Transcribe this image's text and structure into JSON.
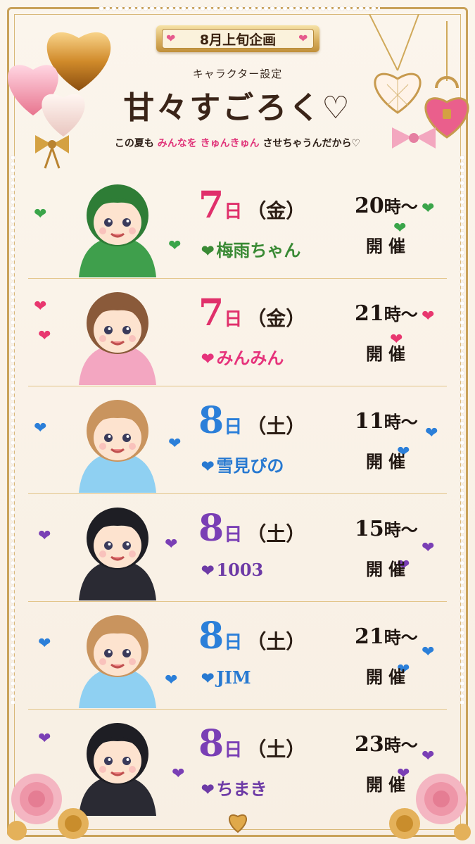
{
  "header": {
    "banner": "8月上旬企画",
    "subtitle": "キャラクター設定",
    "title": "甘々すごろく♡",
    "tagline_parts": [
      "この夏も",
      "みんなを",
      "きゅんきゅん",
      "させちゃうんだから♡"
    ]
  },
  "rows": [
    {
      "day": "7",
      "day_suffix": "日",
      "weekday": "（金）",
      "name": "梅雨ちゃん",
      "time": "20",
      "time_suffix": "時〜",
      "held": "開催",
      "heart": "💚",
      "theme": "green",
      "num_color": "#e0306b"
    },
    {
      "day": "7",
      "day_suffix": "日",
      "weekday": "（金）",
      "name": "みんみん",
      "time": "21",
      "time_suffix": "時〜",
      "held": "開催",
      "heart": "❤",
      "theme": "pink",
      "num_color": "#e0306b"
    },
    {
      "day": "8",
      "day_suffix": "日",
      "weekday": "（土）",
      "name": "雪見ぴの",
      "time": "11",
      "time_suffix": "時〜",
      "held": "開催",
      "heart": "💙",
      "theme": "blue",
      "num_color": "#2b7fd9"
    },
    {
      "day": "8",
      "day_suffix": "日",
      "weekday": "（土）",
      "name": "1003",
      "time": "15",
      "time_suffix": "時〜",
      "held": "開催",
      "heart": "💜",
      "theme": "purple",
      "num_color": "#7a3fb5"
    },
    {
      "day": "8",
      "day_suffix": "日",
      "weekday": "（土）",
      "name": "JIM",
      "time": "21",
      "time_suffix": "時〜",
      "held": "開催",
      "heart": "💙",
      "theme": "blue",
      "num_color": "#2b7fd9"
    },
    {
      "day": "8",
      "day_suffix": "日",
      "weekday": "（土）",
      "name": "ちまき",
      "time": "23",
      "time_suffix": "時〜",
      "held": "開催",
      "heart": "💜",
      "theme": "purple",
      "num_color": "#7a3fb5"
    }
  ],
  "colors": {
    "gold": "#c9a25a",
    "background": "#f8efe3",
    "pink": "#e0306b",
    "blue": "#2b7fd9",
    "purple": "#7a3fb5",
    "green": "#3aa54a"
  }
}
